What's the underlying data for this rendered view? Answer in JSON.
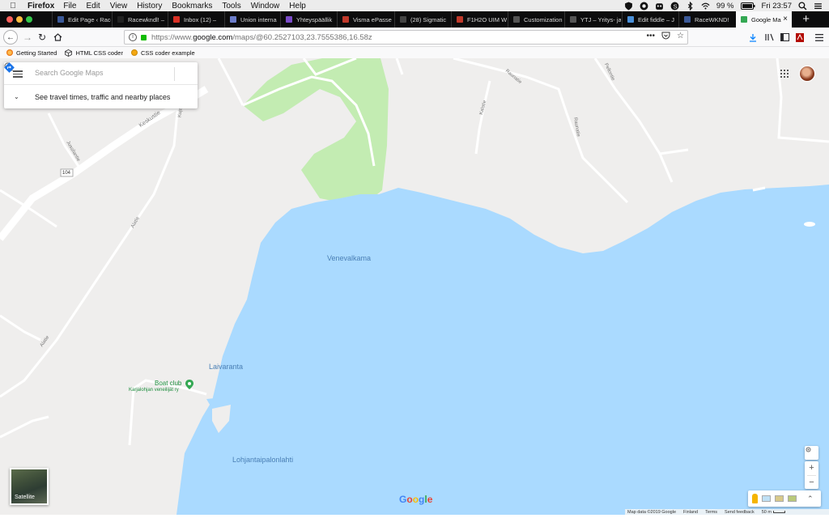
{
  "menubar": {
    "app_name": "Firefox",
    "items": [
      "File",
      "Edit",
      "View",
      "History",
      "Bookmarks",
      "Tools",
      "Window",
      "Help"
    ],
    "battery": "99 %",
    "clock": "Fri 23:57"
  },
  "tabs": [
    {
      "label": "Edit Page ‹ Racew",
      "color": "#3b5998"
    },
    {
      "label": "Racewkndl! – ",
      "color": "#222222"
    },
    {
      "label": "Inbox (12) – ",
      "color": "#d93025"
    },
    {
      "label": "Union interna",
      "color": "#6b7cc9"
    },
    {
      "label": "Yhteyspäällik",
      "color": "#7b4bc9"
    },
    {
      "label": "Visma ePasse",
      "color": "#c0392b"
    },
    {
      "label": "(28) Sigmatic",
      "color": "#444444"
    },
    {
      "label": "F1H2O UIM W",
      "color": "#c0392b"
    },
    {
      "label": "Customization – ",
      "color": "#555555"
    },
    {
      "label": "YTJ – Yritys- ja yh",
      "color": "#555555"
    },
    {
      "label": "Edit fiddle – J",
      "color": "#4a90d9"
    },
    {
      "label": "RaceWKND!",
      "color": "#3b5998"
    },
    {
      "label": "Google Ma",
      "color": "#34a853",
      "active": true
    }
  ],
  "urlbar": {
    "proto": "https://www.",
    "host": "google.com",
    "rest": "/maps/@60.2527103,23.7555386,16.58z"
  },
  "bookmarks": [
    "Getting Started",
    "HTML CSS coder",
    "CSS coder example"
  ],
  "search": {
    "placeholder": "Search Google Maps",
    "travel_label": "See travel times, traffic and nearby places"
  },
  "map": {
    "places": {
      "venevalkama": "Venevalkama",
      "laivaranta": "Laivaranta",
      "lohjantaipalonlahti": "Lohjantaipalonlahti"
    },
    "poi": {
      "name": "Boat club",
      "subtitle": "Karjalohjan veneilijät ry"
    },
    "roads": {
      "keskustie": "Keskustie",
      "route": "104",
      "jussilantie": "Jussilantie",
      "alatie1": "Alatie",
      "alatie2": "Alatie",
      "kuja": "Kuja",
      "raunatie1": "Raunatie",
      "raunatie2": "Raunatie",
      "kalatie": "Kalatie",
      "pellontie": "Pellontie"
    },
    "satellite_label": "Satellite",
    "logo": "Google",
    "attribution": {
      "data": "Map data ©2019 Google",
      "country": "Finland",
      "terms": "Terms",
      "feedback": "Send feedback",
      "scale": "50 m"
    },
    "colors": {
      "water": "#aadaff",
      "land": "#efeeed",
      "park": "#c3ecb2",
      "road": "#ffffff"
    }
  }
}
